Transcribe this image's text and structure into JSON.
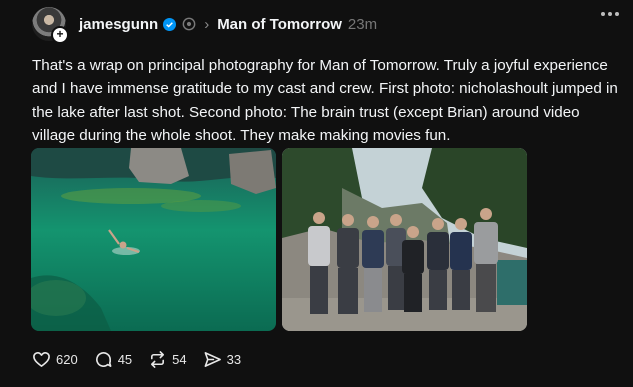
{
  "post": {
    "username": "jamesgunn",
    "topic": "Man of Tomorrow",
    "time": "23m",
    "text": "That's a wrap on principal photography for Man of Tomorrow. Truly a joyful experience and I have immense gratitude to my cast and crew. First photo: nicholashoult jumped in the lake after last shot. Second photo: The brain trust (except Brian) around video village during the whole shoot. They make making movies fun."
  },
  "actions": {
    "likes": "620",
    "replies": "45",
    "reposts": "54",
    "shares": "33"
  },
  "icons": [
    "verified-icon",
    "feed-icon",
    "more-icon",
    "heart-icon",
    "reply-icon",
    "repost-icon",
    "share-icon"
  ],
  "colors": {
    "background": "#101010",
    "verified": "#0095f6",
    "text": "#f3f5f7",
    "muted": "#777777"
  }
}
